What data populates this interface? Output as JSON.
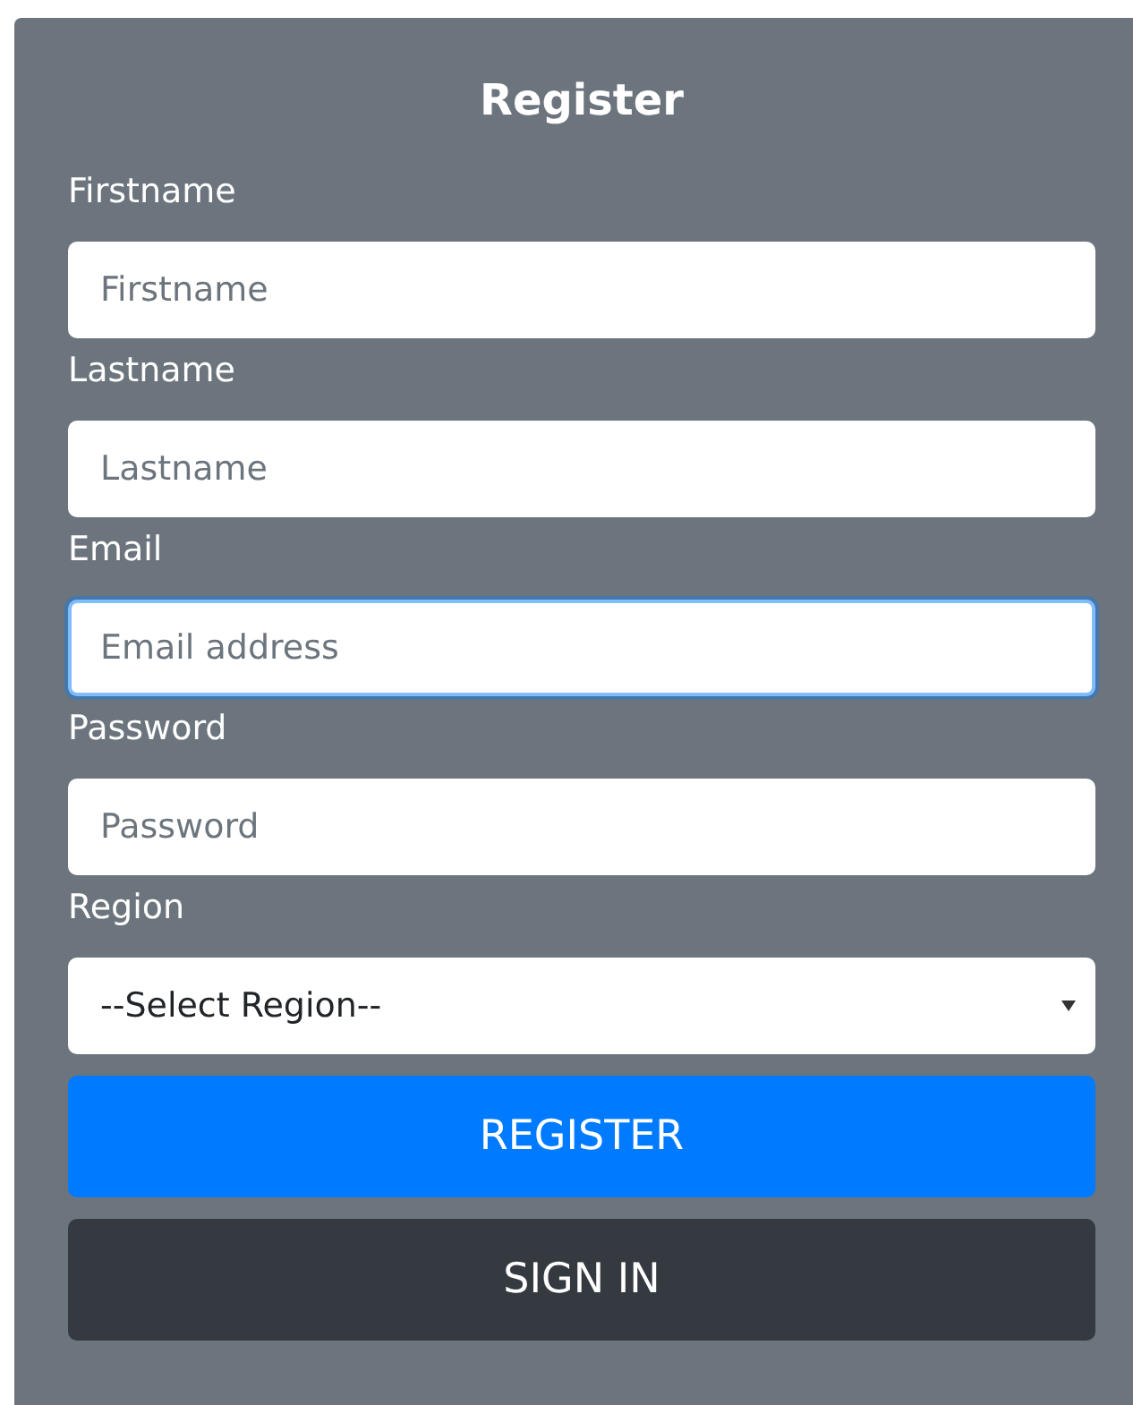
{
  "form": {
    "title": "Register",
    "fields": [
      {
        "kind": "text",
        "label": "Firstname",
        "placeholder": "Firstname",
        "focused": false
      },
      {
        "kind": "text",
        "label": "Lastname",
        "placeholder": "Lastname",
        "focused": false
      },
      {
        "kind": "text",
        "label": "Email",
        "placeholder": "Email address",
        "focused": true
      },
      {
        "kind": "text",
        "label": "Password",
        "placeholder": "Password",
        "focused": false
      },
      {
        "kind": "select",
        "label": "Region",
        "value": "--Select Region--",
        "focused": false
      }
    ],
    "buttons": [
      {
        "kind": "primary",
        "label": "REGISTER"
      },
      {
        "kind": "dark",
        "label": "SIGN IN"
      }
    ]
  }
}
